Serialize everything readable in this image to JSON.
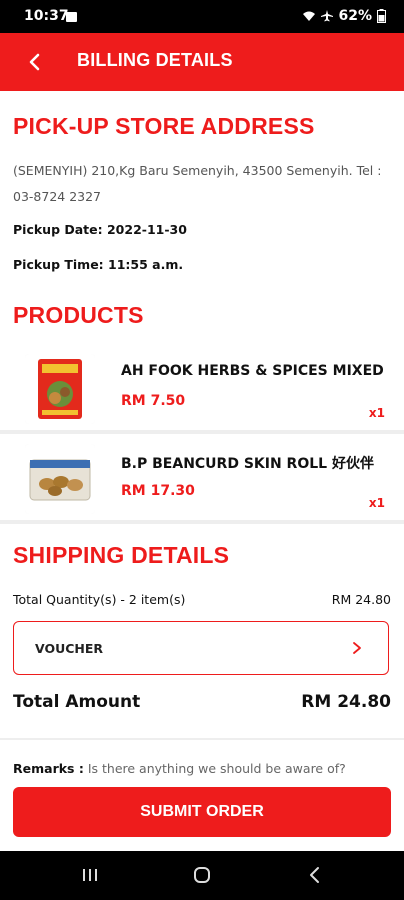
{
  "status_bar": {
    "time": "10:37",
    "battery": "62%"
  },
  "app_bar": {
    "title": "BILLING DETAILS",
    "back_icon": "chevron-left-icon"
  },
  "store": {
    "heading": "PICK-UP STORE ADDRESS",
    "address": "(SEMENYIH) 210,Kg Baru Semenyih, 43500 Semenyih. Tel : 03-8724 2327",
    "pickup_date": "Pickup Date: 2022-11-30",
    "pickup_time": "Pickup Time: 11:55 a.m."
  },
  "products": {
    "heading": "PRODUCTS",
    "items": [
      {
        "name": "AH FOOK HERBS & SPICES MIXED",
        "price": "RM 7.50",
        "qty": "x1"
      },
      {
        "name": "B.P BEANCURD SKIN ROLL 好伙伴",
        "price": "RM 17.30",
        "qty": "x1"
      }
    ]
  },
  "shipping": {
    "heading": "SHIPPING DETAILS",
    "total_qty_label": "Total Quantity(s) - 2 item(s)",
    "total_qty_value": "RM 24.80",
    "voucher_label": "VOUCHER",
    "total_amount_label": "Total Amount",
    "total_amount_value": "RM 24.80",
    "remarks_label": "Remarks :",
    "remarks_placeholder": "Is there anything we should be aware of?"
  },
  "actions": {
    "submit_label": "SUBMIT ORDER"
  },
  "colors": {
    "accent": "#ee1c1c",
    "background": "#ffffff",
    "divider": "#eeeeee"
  }
}
